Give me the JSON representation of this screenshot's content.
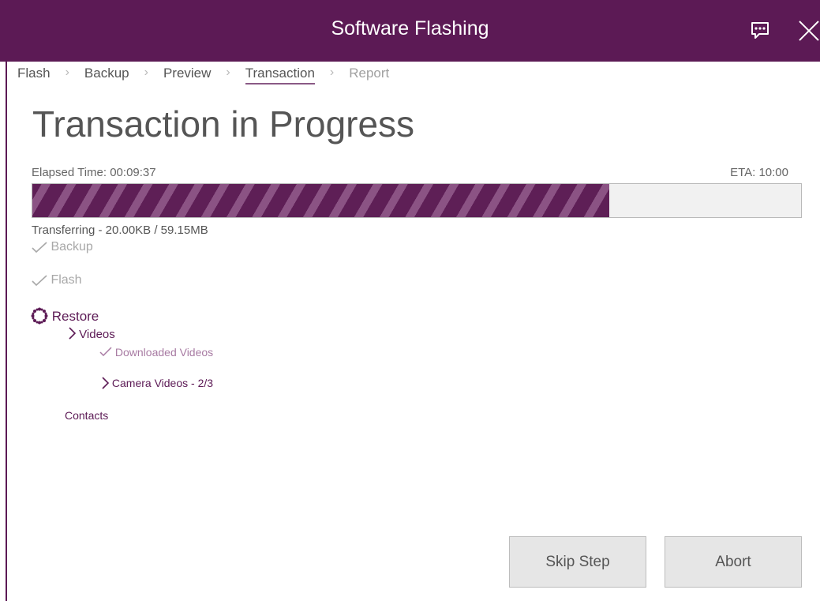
{
  "window": {
    "title": "Software Flashing"
  },
  "breadcrumb": {
    "items": [
      {
        "label": "Flash"
      },
      {
        "label": "Backup"
      },
      {
        "label": "Preview"
      },
      {
        "label": "Transaction"
      },
      {
        "label": "Report"
      }
    ],
    "separator": "›"
  },
  "page": {
    "title": "Transaction in Progress"
  },
  "progress": {
    "elapsed": "Elapsed Time: 00:09:37",
    "eta": "ETA: 10:00",
    "percent": 75,
    "status": "Transferring - 20.00KB / 59.15MB"
  },
  "steps": {
    "backup": {
      "label": "Backup",
      "icon": "check-icon"
    },
    "flash": {
      "label": "Flash",
      "icon": "check-icon"
    },
    "restore": {
      "label": "Restore",
      "icon": "spinner-icon",
      "videos": {
        "label": "Videos",
        "icon": "chevron-right-icon",
        "downloaded": "Downloaded Videos",
        "camera": "Camera Videos - 2/3"
      },
      "contacts": "Contacts"
    }
  },
  "buttons": {
    "skip": "Skip Step",
    "abort": "Abort"
  },
  "colors": {
    "accent": "#5c1a55",
    "stripe_light": "#8b5384",
    "muted": "#a8a8a8"
  }
}
